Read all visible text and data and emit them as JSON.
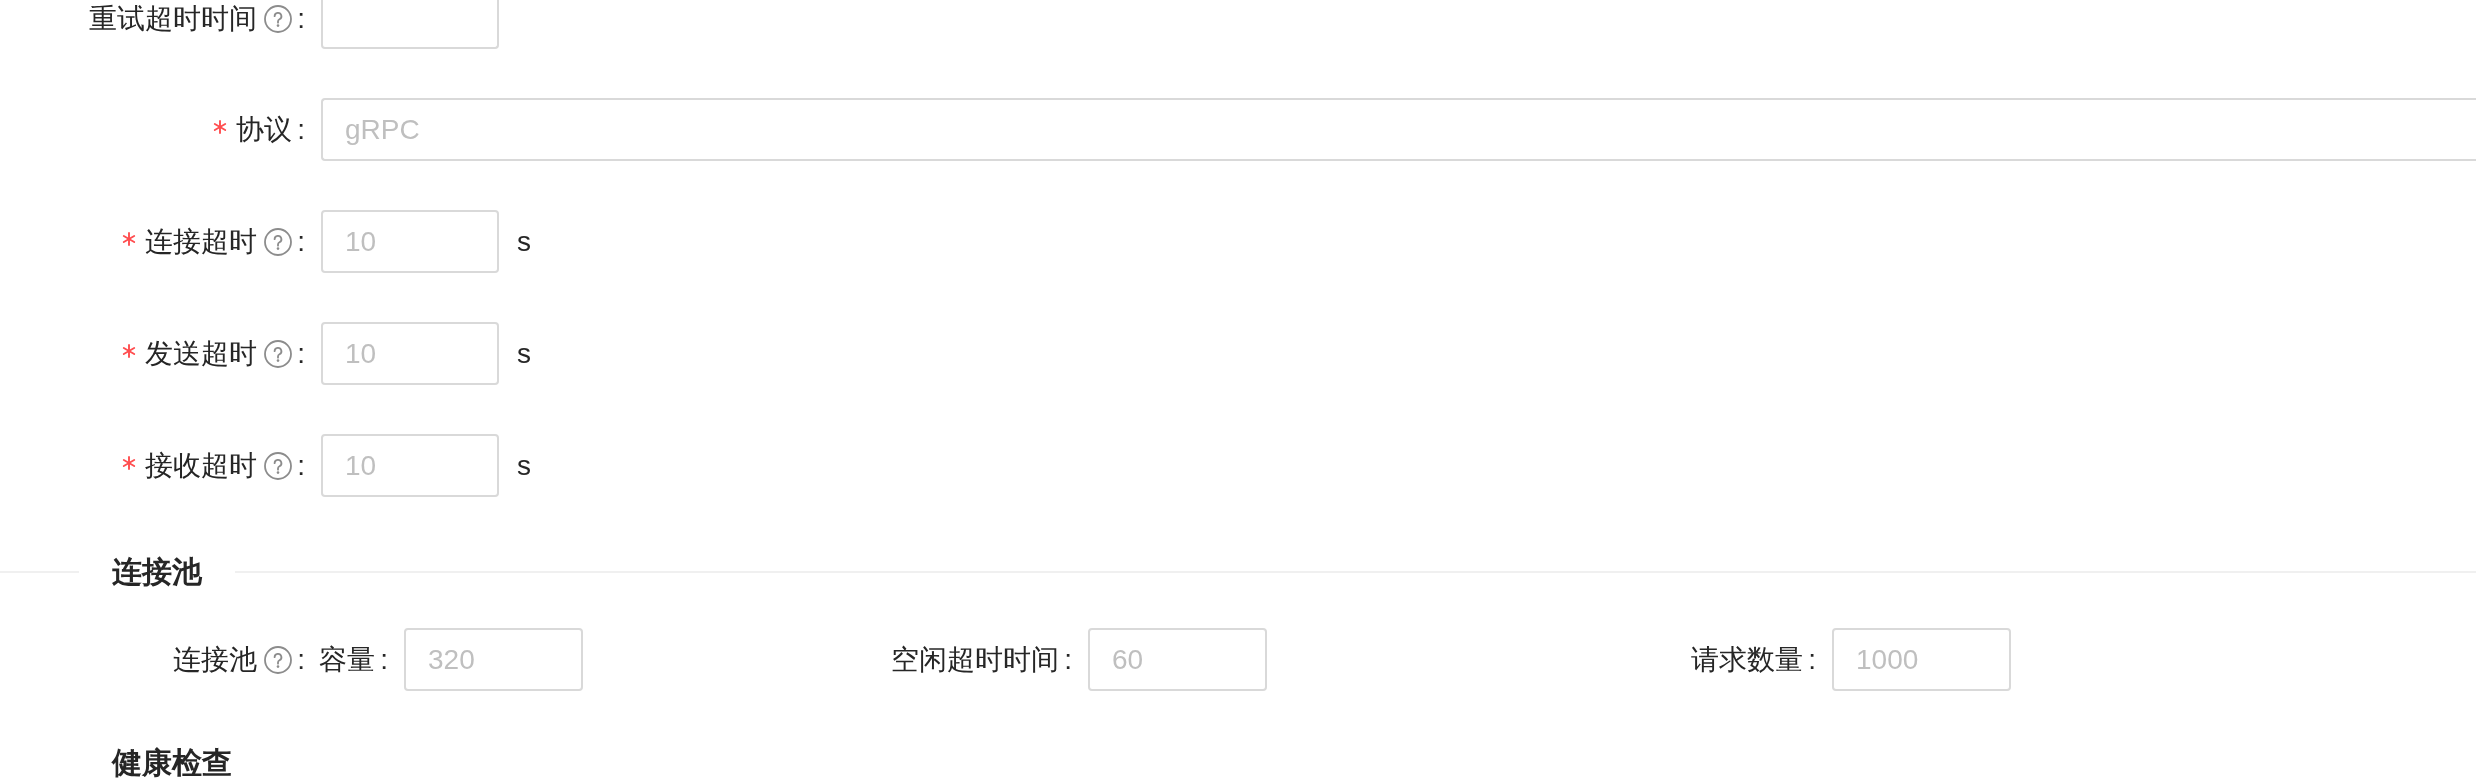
{
  "fields": [
    {
      "label": "重试超时时间",
      "required": false,
      "help_icon": true,
      "colon": ":",
      "kind": "short"
    },
    {
      "label": "协议",
      "required": true,
      "help_icon": false,
      "colon": ":",
      "kind": "wide",
      "placeholder": "gRPC"
    },
    {
      "label": "连接超时",
      "required": true,
      "help_icon": true,
      "colon": ":",
      "kind": "short",
      "placeholder": "10",
      "suffix": "s"
    },
    {
      "label": "发送超时",
      "required": true,
      "help_icon": true,
      "colon": ":",
      "kind": "short",
      "placeholder": "10",
      "suffix": "s"
    },
    {
      "label": "接收超时",
      "required": true,
      "help_icon": true,
      "colon": ":",
      "kind": "short",
      "placeholder": "10",
      "suffix": "s"
    }
  ],
  "pool": {
    "title": "连接池",
    "label": "连接池",
    "help_icon": true,
    "colon": ":",
    "items": [
      {
        "label": "容量",
        "colon": ":",
        "placeholder": "320"
      },
      {
        "label": "空闲超时时间",
        "colon": ":",
        "placeholder": "60"
      },
      {
        "label": "请求数量",
        "colon": ":",
        "placeholder": "1000"
      }
    ]
  },
  "health_check": {
    "title": "健康检查"
  }
}
